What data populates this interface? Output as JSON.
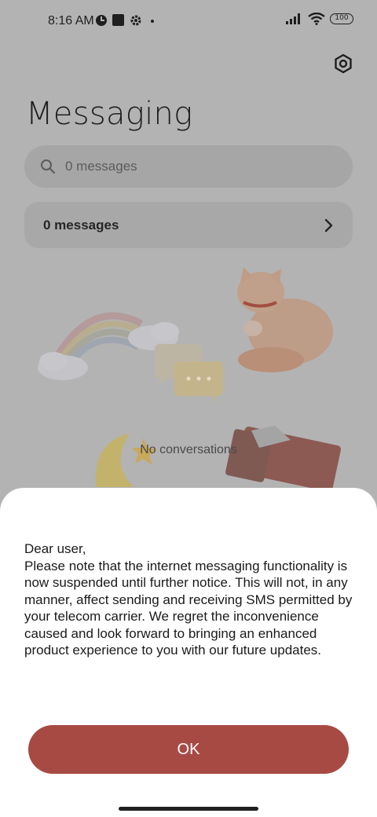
{
  "status_bar": {
    "time": "8:16 AM",
    "battery": "100",
    "icons": [
      "clock-icon",
      "square-notification-icon",
      "gear-icon",
      "dot-icon",
      "signal-icon",
      "wifi-icon",
      "battery-icon"
    ]
  },
  "header": {
    "title": "Messaging",
    "settings_icon": "settings-icon"
  },
  "search": {
    "placeholder": "0 messages",
    "icon": "search-icon"
  },
  "summary": {
    "label": "0 messages",
    "icon": "chevron-right-icon"
  },
  "empty_state": {
    "text": "No conversations"
  },
  "dialog": {
    "message": "Dear user,\nPlease note that the internet messaging functionality is now suspended until further notice. This will not, in any manner, affect sending and receiving SMS permitted by your telecom carrier. We regret the inconvenience caused and look forward to bringing an enhanced product experience to you with our future updates.",
    "ok_label": "OK"
  },
  "colors": {
    "overlay_bg": "#b3b3b3",
    "accent": "#a84a44",
    "dialog_bg": "#ffffff"
  }
}
